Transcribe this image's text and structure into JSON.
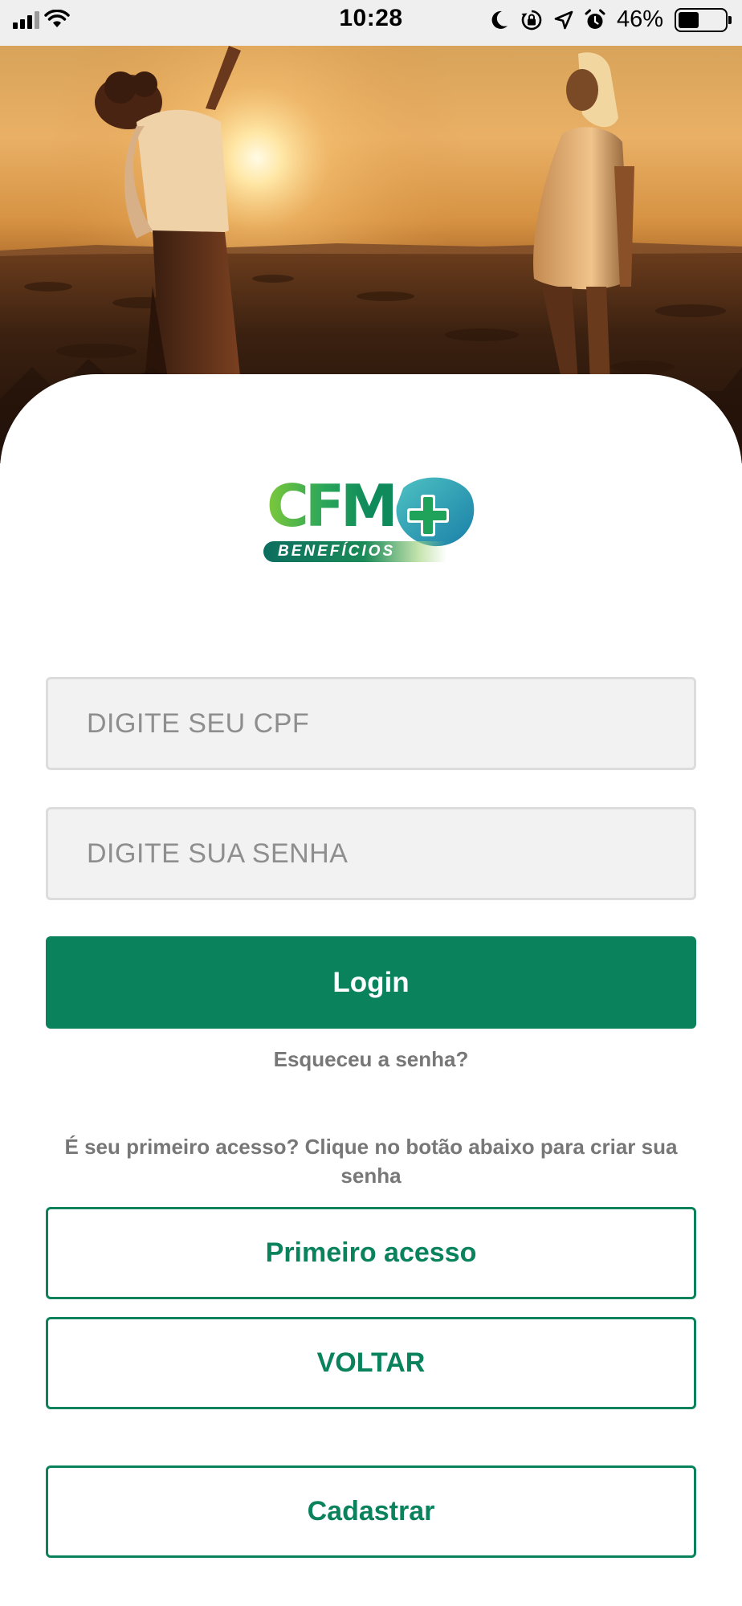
{
  "status_bar": {
    "time": "10:28",
    "battery_percent": "46%",
    "battery_level": 0.46,
    "icons": [
      "signal-icon",
      "wifi-icon",
      "moon-icon",
      "rotation-lock-icon",
      "location-icon",
      "alarm-icon",
      "battery-icon"
    ]
  },
  "hero": {
    "image": "sunset-couple-photo"
  },
  "logo": {
    "wordmark": "CFM",
    "subtitle": "BENEFÍCIOS"
  },
  "form": {
    "cpf_placeholder": "DIGITE SEU CPF",
    "cpf_value": "",
    "password_placeholder": "DIGITE SUA SENHA",
    "password_value": "",
    "login_label": "Login",
    "forgot_label": "Esqueceu a senha?"
  },
  "first_access": {
    "prompt": "É seu primeiro acesso? Clique no botão abaixo para criar sua senha",
    "button_label": "Primeiro acesso"
  },
  "back_label": "VOLTAR",
  "register_label": "Cadastrar",
  "colors": {
    "primary": "#0a825c",
    "muted_text": "#777777",
    "field_bg": "#f2f2f2",
    "field_border": "#dcdcdc"
  }
}
